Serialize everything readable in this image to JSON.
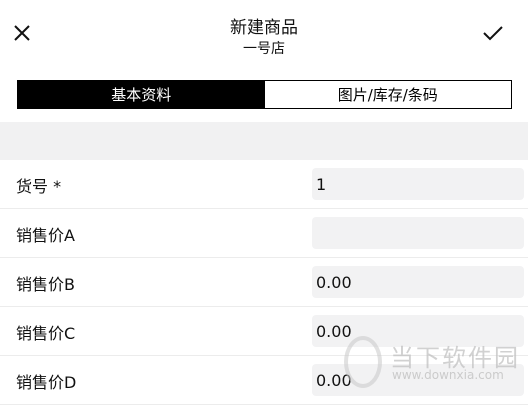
{
  "header": {
    "title": "新建商品",
    "subtitle": "一号店",
    "close_icon": "close-icon",
    "confirm_icon": "check-icon"
  },
  "tabs": [
    {
      "label": "基本资料",
      "active": true
    },
    {
      "label": "图片/库存/条码",
      "active": false
    }
  ],
  "form": {
    "rows": [
      {
        "label": "货号 *",
        "value": ""
      },
      {
        "label": "销售价A",
        "value": ""
      },
      {
        "label": "销售价B",
        "value": "0.00"
      },
      {
        "label": "销售价C",
        "value": "0.00"
      },
      {
        "label": "销售价D",
        "value": "0.00"
      }
    ],
    "item_number_value": "1"
  },
  "watermark": {
    "text": "当下软件园",
    "url": "www.downxia.com"
  },
  "colors": {
    "accent": "#000000",
    "field_bg": "#f2f2f3",
    "section_bg": "#f1f1f2"
  }
}
